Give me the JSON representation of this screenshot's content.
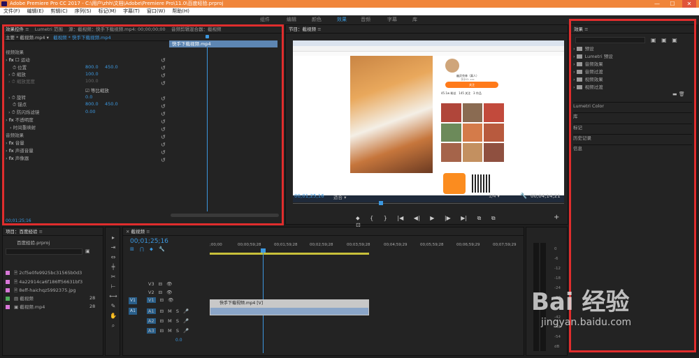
{
  "window": {
    "title": "Adobe Premiere Pro CC 2017 - C:\\用户\\zhh\\文档\\Adobe\\Premiere Pro\\11.0\\百度经验.prproj",
    "min": "—",
    "max": "☐",
    "close": "✕"
  },
  "menu": [
    "文件(F)",
    "编辑(E)",
    "剪辑(C)",
    "序列(S)",
    "标记(M)",
    "字幕(T)",
    "窗口(W)",
    "帮助(H)"
  ],
  "workspaces": [
    "组件",
    "编辑",
    "颜色",
    "效果",
    "音频",
    "字幕",
    "库"
  ],
  "effect_controls": {
    "tabs": [
      "效果控件",
      "Lumetri 范围",
      "源：截视频：快手下载视频.mp4: 00;00;00;00",
      "音频剪辑混合器：截视频"
    ],
    "source_label": "主要 * 截视频.mp4",
    "clip_label": "截视频 * 快手下载视频.mp4",
    "clip_bar": "快手下载视频.mp4",
    "video_effects": "视频效果",
    "motion": "运动",
    "position": "位置",
    "position_x": "800.0",
    "position_y": "450.0",
    "scale": "缩放",
    "scale_val": "100.0",
    "scale_width": "缩放宽度",
    "scale_width_val": "100.0",
    "uniform_scale": "等比缩放",
    "rotation": "旋转",
    "rotation_val": "0.0",
    "anchor": "锚点",
    "anchor_x": "800.0",
    "anchor_y": "450.0",
    "flicker": "防闪烁滤镜",
    "flicker_val": "0.00",
    "opacity": "不透明度",
    "time_remap": "时间重映射",
    "audio_effects": "音频效果",
    "volume": "音量",
    "channel_volume": "声道音量",
    "panner": "声像器",
    "timecode": "00;01;25;16"
  },
  "program": {
    "tab": "节目：截视频",
    "timecode": "00;01;25;16",
    "fit": "适合",
    "ratio": "1/4",
    "duration": "00;04;14;21",
    "profile_name": "幽灵克林（真人）",
    "profile_sub": "快手ID: xxx",
    "follow_btn": "关注",
    "stat1": "45.1w",
    "stat1_label": "粉丝",
    "stat2": "145",
    "stat2_label": "关注",
    "stat3": "3",
    "stat3_label": "作品"
  },
  "project": {
    "tab": "项目：百度经验",
    "file": "百度经验.prproj",
    "items": [
      {
        "name": "2cf5e0fe9925bc31565b0d3",
        "color": "#d877d8"
      },
      {
        "name": "4a22914ca6f186ff56631bf3",
        "color": "#d877d8"
      },
      {
        "name": "8eff-haichqz5992375.jpg",
        "color": "#d877d8"
      },
      {
        "name": "截视频",
        "color": "#4fae5a",
        "count": "28"
      },
      {
        "name": "截视频.mp4",
        "color": "#d877d8",
        "count": "28"
      }
    ]
  },
  "timeline": {
    "tab": "截视频",
    "timecode": "00;01;25;16",
    "ruler": [
      ";00;00",
      "00;00;59;28",
      "00;01;59;28",
      "00;02;59;28",
      "00;03;59;28",
      "00;04;59;29",
      "00;05;59;28",
      "00;06;59;29",
      "00;07;59;29"
    ],
    "tracks": [
      "V3",
      "V2",
      "V1",
      "A1",
      "A2",
      "A3"
    ],
    "src_v": "V1",
    "src_a": "A1",
    "clip_label": "快手下载视频.mp4 [V]",
    "master_val": "0.0"
  },
  "meter": {
    "ticks": [
      "0",
      "-6",
      "-12",
      "-18",
      "-24",
      "-30",
      "-36",
      "-42",
      "-48",
      "-54",
      "dB"
    ]
  },
  "effects_panel": {
    "tab": "效果",
    "folders": [
      "预设",
      "Lumetri 预设",
      "音频效果",
      "音频过渡",
      "视频效果",
      "视频过渡"
    ],
    "sections": [
      "Lumetri Color",
      "库",
      "标记",
      "历史记录",
      "信息"
    ]
  },
  "watermark": {
    "brand": "Bai 经验",
    "url": "jingyan.baidu.com"
  }
}
